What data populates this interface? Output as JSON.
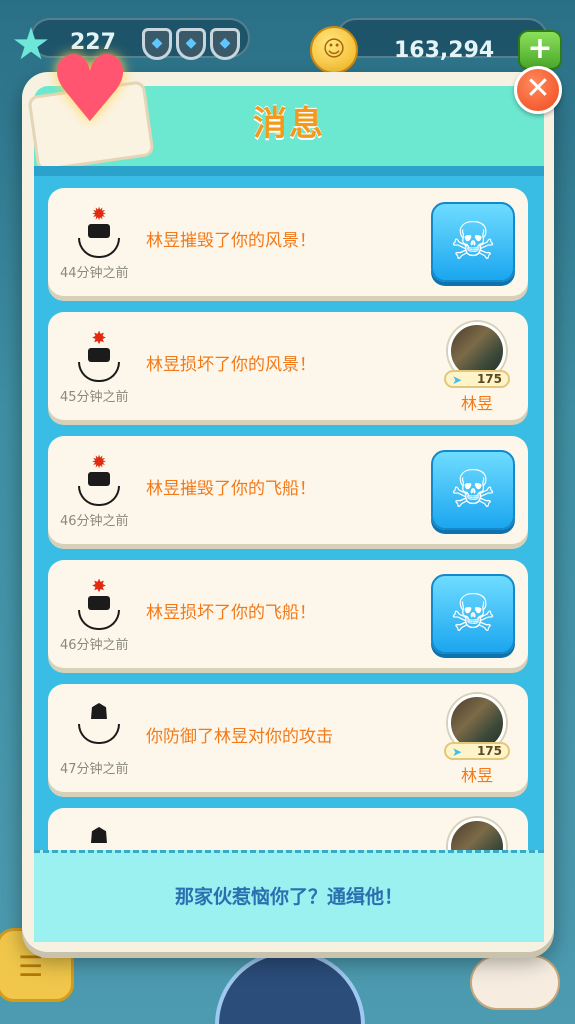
{
  "hud": {
    "level": "227",
    "coins": "163,294",
    "plus_label": "+",
    "shield_icons": [
      "shield-icon",
      "shield-icon",
      "shield-icon"
    ],
    "star_icon": "star-icon",
    "coin_icon": "coin-icon"
  },
  "dialog": {
    "title": "消息",
    "close_label": "✕",
    "footer_text": "那家伙惹恼你了？通缉他！"
  },
  "messages": [
    {
      "icon": "fire-icon",
      "text": "林昱摧毁了你的风景！",
      "time": "44分钟之前",
      "action": "skull-button"
    },
    {
      "icon": "explosion-icon",
      "text": "林昱损坏了你的风景！",
      "time": "45分钟之前",
      "action": "avatar",
      "avatar_value": "175",
      "avatar_name": "林昱"
    },
    {
      "icon": "fire-icon",
      "text": "林昱摧毁了你的飞船！",
      "time": "46分钟之前",
      "action": "skull-button"
    },
    {
      "icon": "explosion-icon",
      "text": "林昱损坏了你的飞船！",
      "time": "46分钟之前",
      "action": "skull-button"
    },
    {
      "icon": "shield-defense-icon",
      "text_prefix": "你防御了",
      "text_name": "林昱",
      "text_suffix": "对你的攻击",
      "time": "47分钟之前",
      "action": "avatar",
      "avatar_value": "175",
      "avatar_name": "林昱"
    }
  ],
  "colors": {
    "header": "#6be8cf",
    "list_bg": "#39bde4",
    "title": "#f39a1c",
    "message_text": "#f27a1a",
    "skull_button": "#1ba6ef",
    "footer_text": "#2b6fb0"
  }
}
